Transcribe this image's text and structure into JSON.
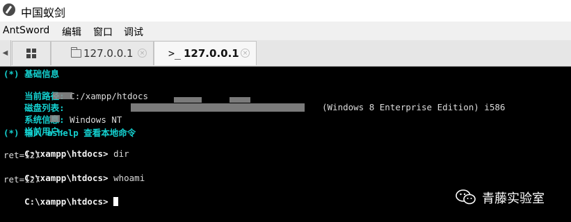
{
  "window": {
    "title": "中国蚁剑"
  },
  "menu": [
    "AntSword",
    "编辑",
    "窗口",
    "调试"
  ],
  "tabs": [
    {
      "label": "127.0.0.1",
      "icon": "folder-icon",
      "close": "×"
    },
    {
      "label": "127.0.0.1",
      "icon": "terminal-icon",
      "close": "×"
    }
  ],
  "terminal": {
    "section_basic": "(*) 基础信息",
    "cwd_label": "当前路径:",
    "cwd_value": "C:/xampp/htdocs",
    "disk_label": "磁盘列表:",
    "sys_label": "系统信息:",
    "sys_value_left": "Windows NT",
    "sys_value_right": "(Windows 8 Enterprise Edition) i586",
    "user_label": "当前用户:",
    "hint": "(*) 输入 ashelp 查看本地命令",
    "prompt": "C:\\xampp\\htdocs>",
    "commands": [
      {
        "cmd": "dir",
        "ret": "ret=127"
      },
      {
        "cmd": "whoami",
        "ret": "ret=127"
      }
    ]
  },
  "watermark": {
    "text": "青藤实验室"
  },
  "colors": {
    "terminal_bg": "#000000",
    "accent": "#14d0cf",
    "tab_bg": "#e6e6e6"
  }
}
